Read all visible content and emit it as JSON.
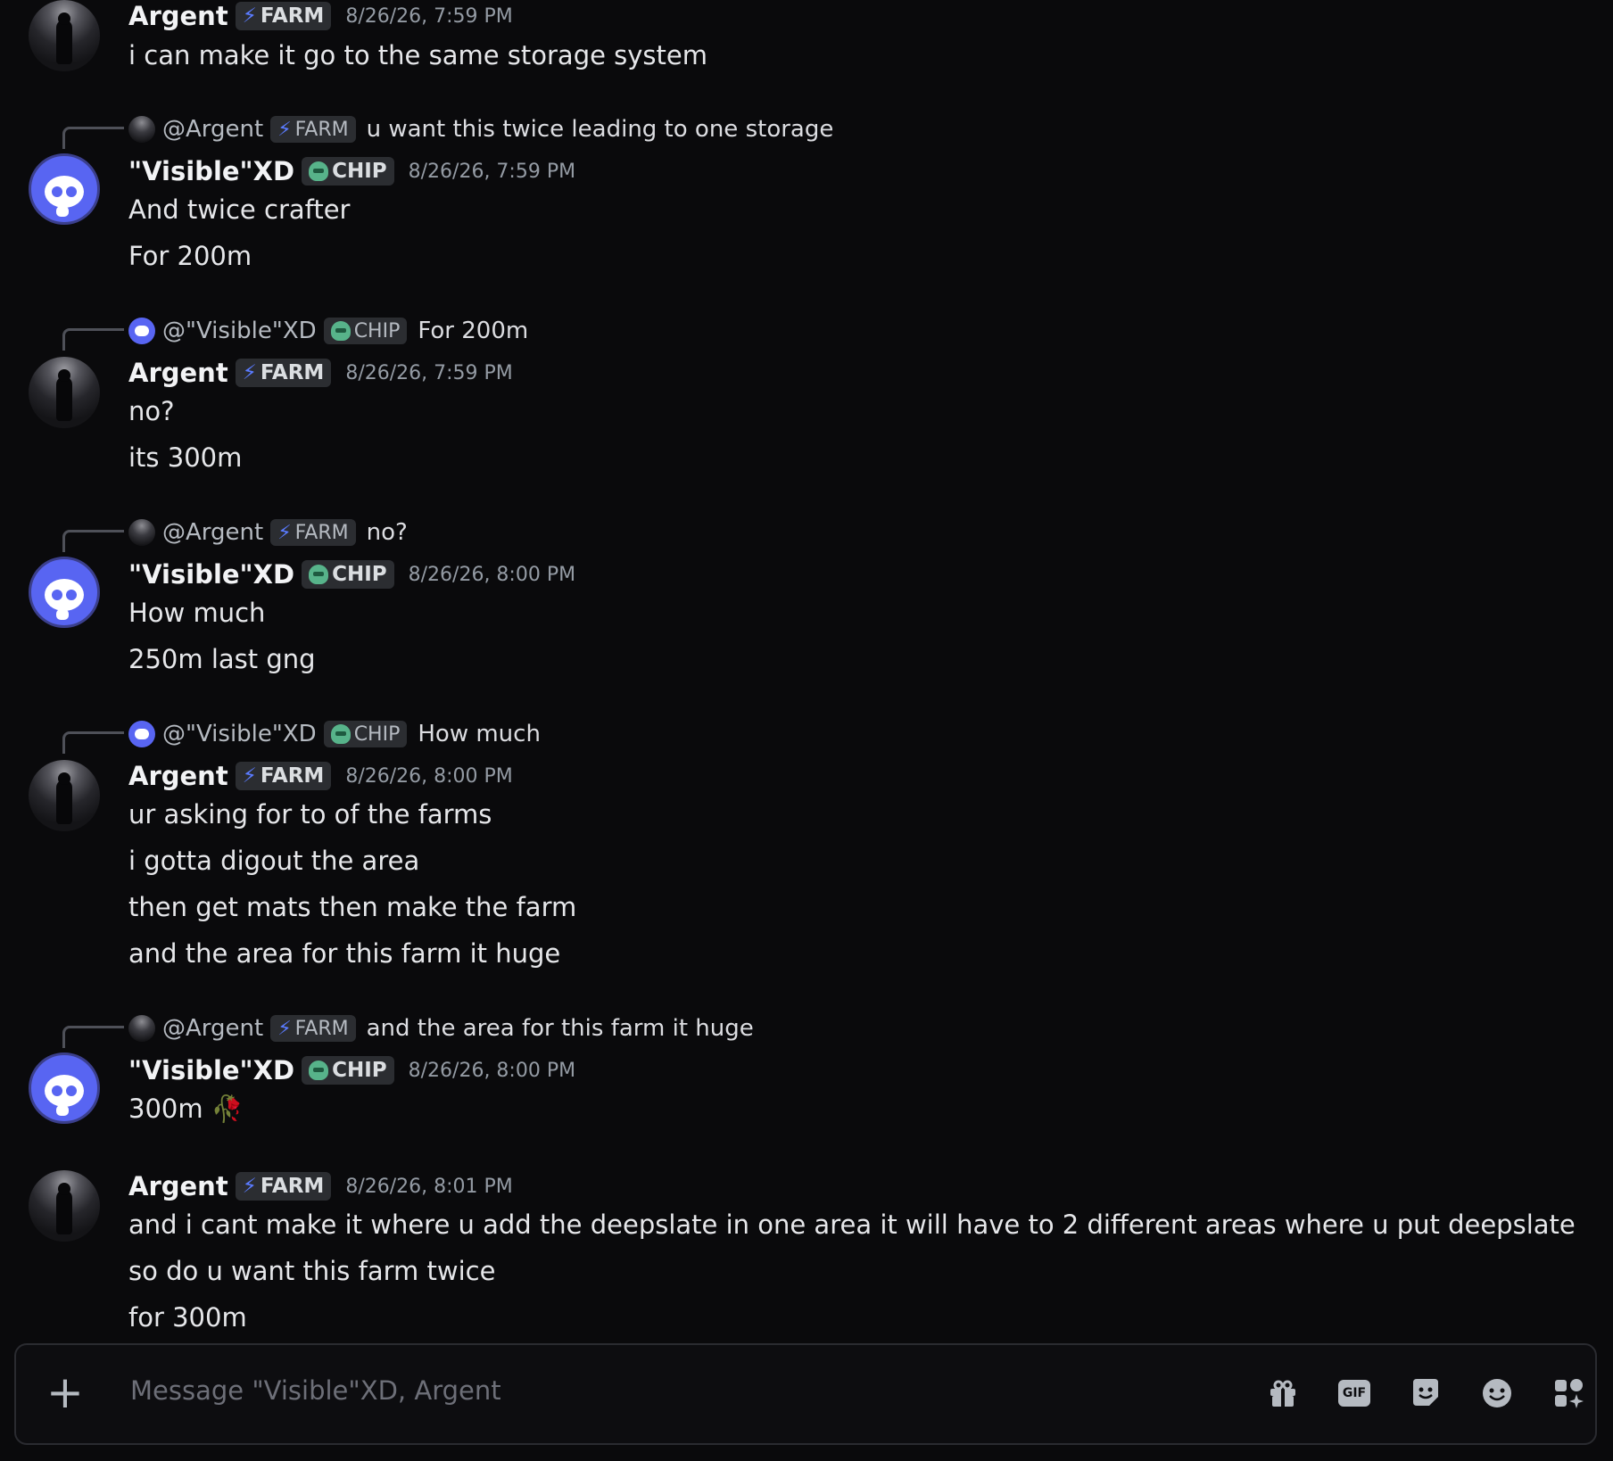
{
  "tags": {
    "farm": "FARM",
    "chip": "CHIP"
  },
  "messages": [
    {
      "author": "Argent",
      "timestamp": "8/26/26, 7:59 PM",
      "lines": [
        "i can make it go to the same storage system"
      ]
    },
    {
      "reply_to": "@Argent",
      "reply_text": "u want this twice leading to one storage",
      "author": "\"Visible\"XD",
      "timestamp": "8/26/26, 7:59 PM",
      "lines": [
        "And twice crafter",
        "For 200m"
      ]
    },
    {
      "reply_to": "@\"Visible\"XD",
      "reply_text": "For 200m",
      "author": "Argent",
      "timestamp": "8/26/26, 7:59 PM",
      "lines": [
        "no?",
        "its 300m"
      ]
    },
    {
      "reply_to": "@Argent",
      "reply_text": "no?",
      "author": "\"Visible\"XD",
      "timestamp": "8/26/26, 8:00 PM",
      "lines": [
        "How much",
        "250m last gng"
      ]
    },
    {
      "reply_to": "@\"Visible\"XD",
      "reply_text": "How much",
      "author": "Argent",
      "timestamp": "8/26/26, 8:00 PM",
      "lines": [
        "ur asking for to of the farms",
        "i gotta digout the area",
        "then get mats then make the farm",
        "and the area for this farm it huge"
      ]
    },
    {
      "reply_to": "@Argent",
      "reply_text": "and the area for this farm it huge",
      "author": "\"Visible\"XD",
      "timestamp": "8/26/26, 8:00 PM",
      "lines": [
        "300m 🥀"
      ]
    },
    {
      "author": "Argent",
      "timestamp": "8/26/26, 8:01 PM",
      "lines": [
        "and i cant make it where u add the deepslate in one area it will have to 2 different areas where u put deepslate",
        "so do u want this farm twice",
        "for 300m"
      ]
    }
  ],
  "composer": {
    "placeholder": "Message \"Visible\"XD, Argent",
    "gif_label": "GIF"
  }
}
